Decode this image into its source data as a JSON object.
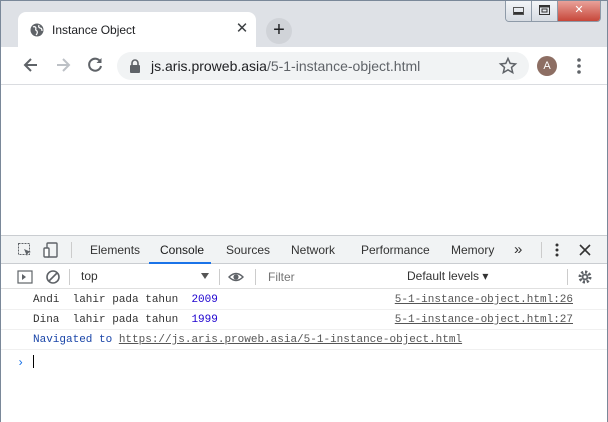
{
  "browser": {
    "tab_title": "Instance Object",
    "url_host": "js.aris.proweb.asia",
    "url_path": "/5-1-instance-object.html",
    "avatar_letter": "A",
    "icons": [
      "globe-icon",
      "close-icon",
      "plus-icon",
      "back-arrow-icon",
      "forward-arrow-icon",
      "reload-icon",
      "lock-icon",
      "star-icon",
      "vertical-dots-icon"
    ],
    "window_controls": [
      "minimize-icon",
      "restore-icon",
      "close-icon"
    ]
  },
  "devtools": {
    "tabs": [
      "Elements",
      "Console",
      "Sources",
      "Network",
      "Performance",
      "Memory"
    ],
    "active_tab": "Console",
    "more_glyph": "»",
    "context": "top",
    "filter_placeholder": "Filter",
    "levels": "Default levels ▾",
    "logs": [
      {
        "text": "Andi  lahir pada tahun  ",
        "number": "2009",
        "source": "5-1-instance-object.html:26"
      },
      {
        "text": "Dina  lahir pada tahun  ",
        "number": "1999",
        "source": "5-1-instance-object.html:27"
      }
    ],
    "navigated_prefix": "Navigated to ",
    "navigated_url": "https://js.aris.proweb.asia/5-1-instance-object.html",
    "prompt_glyph": "›",
    "accent_color": "#1a73e8"
  }
}
